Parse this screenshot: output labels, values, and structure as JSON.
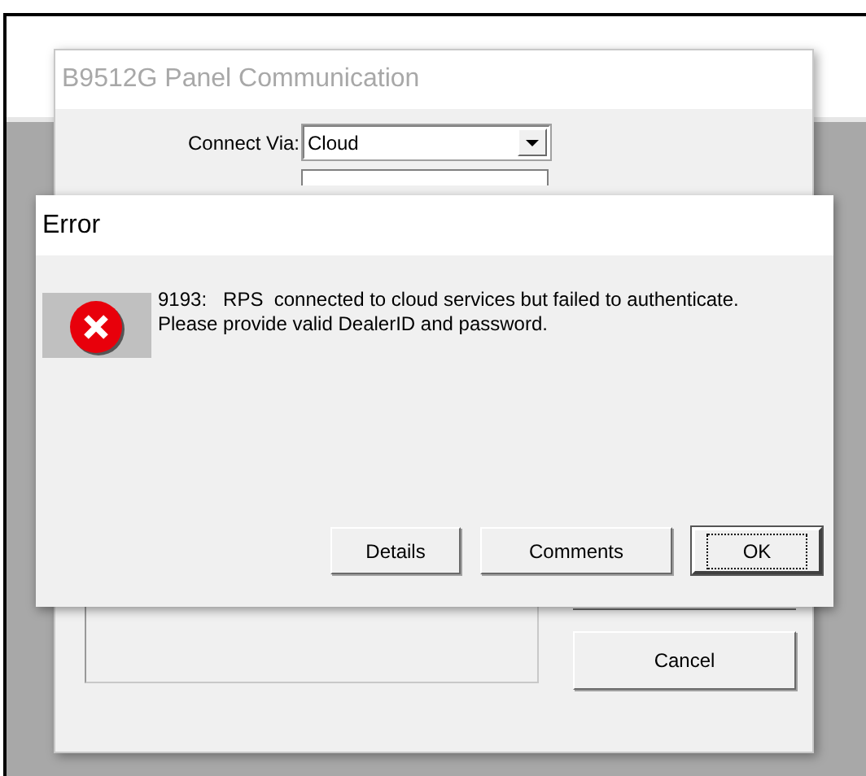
{
  "background_window": {
    "title": "B9512G Panel Communication",
    "connect_via": {
      "label": "Connect Via:",
      "value": "Cloud"
    },
    "buttons": [
      {
        "label": "Cancel",
        "default": false
      }
    ]
  },
  "error_dialog": {
    "title": "Error",
    "message_lines": [
      "9193:   RPS  connected to cloud services but failed to authenticate.",
      "Please provide valid DealerID and password."
    ],
    "buttons": [
      {
        "label": "Details",
        "default": false
      },
      {
        "label": "Comments",
        "default": false
      },
      {
        "label": "OK",
        "default": true
      }
    ]
  }
}
